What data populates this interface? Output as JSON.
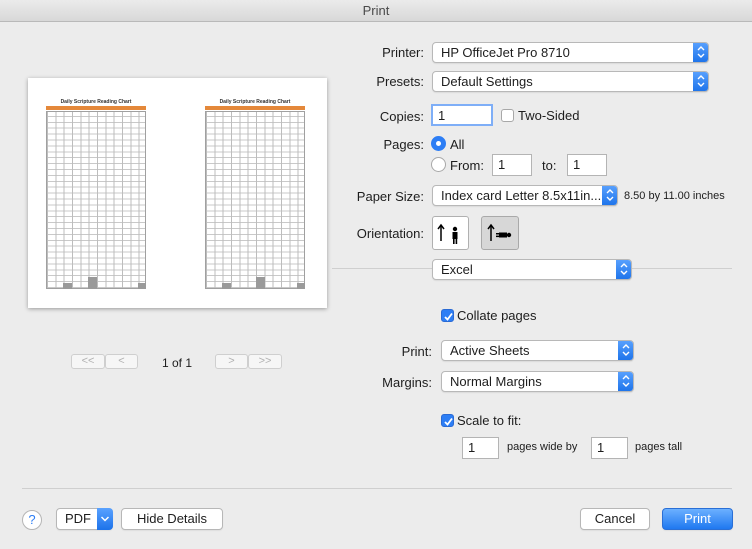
{
  "window": {
    "title": "Print"
  },
  "preview": {
    "sheet_title": "Daily Scripture Reading Chart",
    "page_indicator": "1 of 1",
    "nav_first": "<<",
    "nav_prev": "<",
    "nav_next": ">",
    "nav_last": ">>"
  },
  "printer": {
    "label": "Printer:",
    "value": "HP OfficeJet Pro 8710"
  },
  "presets": {
    "label": "Presets:",
    "value": "Default Settings"
  },
  "copies": {
    "label": "Copies:",
    "value": "1",
    "two_sided_label": "Two-Sided",
    "two_sided_checked": false
  },
  "pages": {
    "label": "Pages:",
    "all_label": "All",
    "from_label": "From:",
    "from_value": "1",
    "to_label": "to:",
    "to_value": "1"
  },
  "paper_size": {
    "label": "Paper Size:",
    "value": "Index card Letter 8.5x11in...",
    "dimensions": "8.50 by 11.00 inches"
  },
  "orientation": {
    "label": "Orientation:",
    "selected": "portrait"
  },
  "app_section": {
    "value": "Excel"
  },
  "collate": {
    "label": "Collate pages",
    "checked": true
  },
  "print_what": {
    "label": "Print:",
    "value": "Active Sheets"
  },
  "margins": {
    "label": "Margins:",
    "value": "Normal Margins"
  },
  "scale": {
    "label": "Scale to fit:",
    "checked": true,
    "wide_value": "1",
    "wide_label": "pages wide by",
    "tall_value": "1",
    "tall_label": "pages tall"
  },
  "footer": {
    "help": "?",
    "pdf_label": "PDF",
    "hide_details_label": "Hide Details",
    "cancel_label": "Cancel",
    "print_label": "Print"
  },
  "colors": {
    "accent": "#2d7ef5",
    "sheet_header": "#e4883a"
  }
}
